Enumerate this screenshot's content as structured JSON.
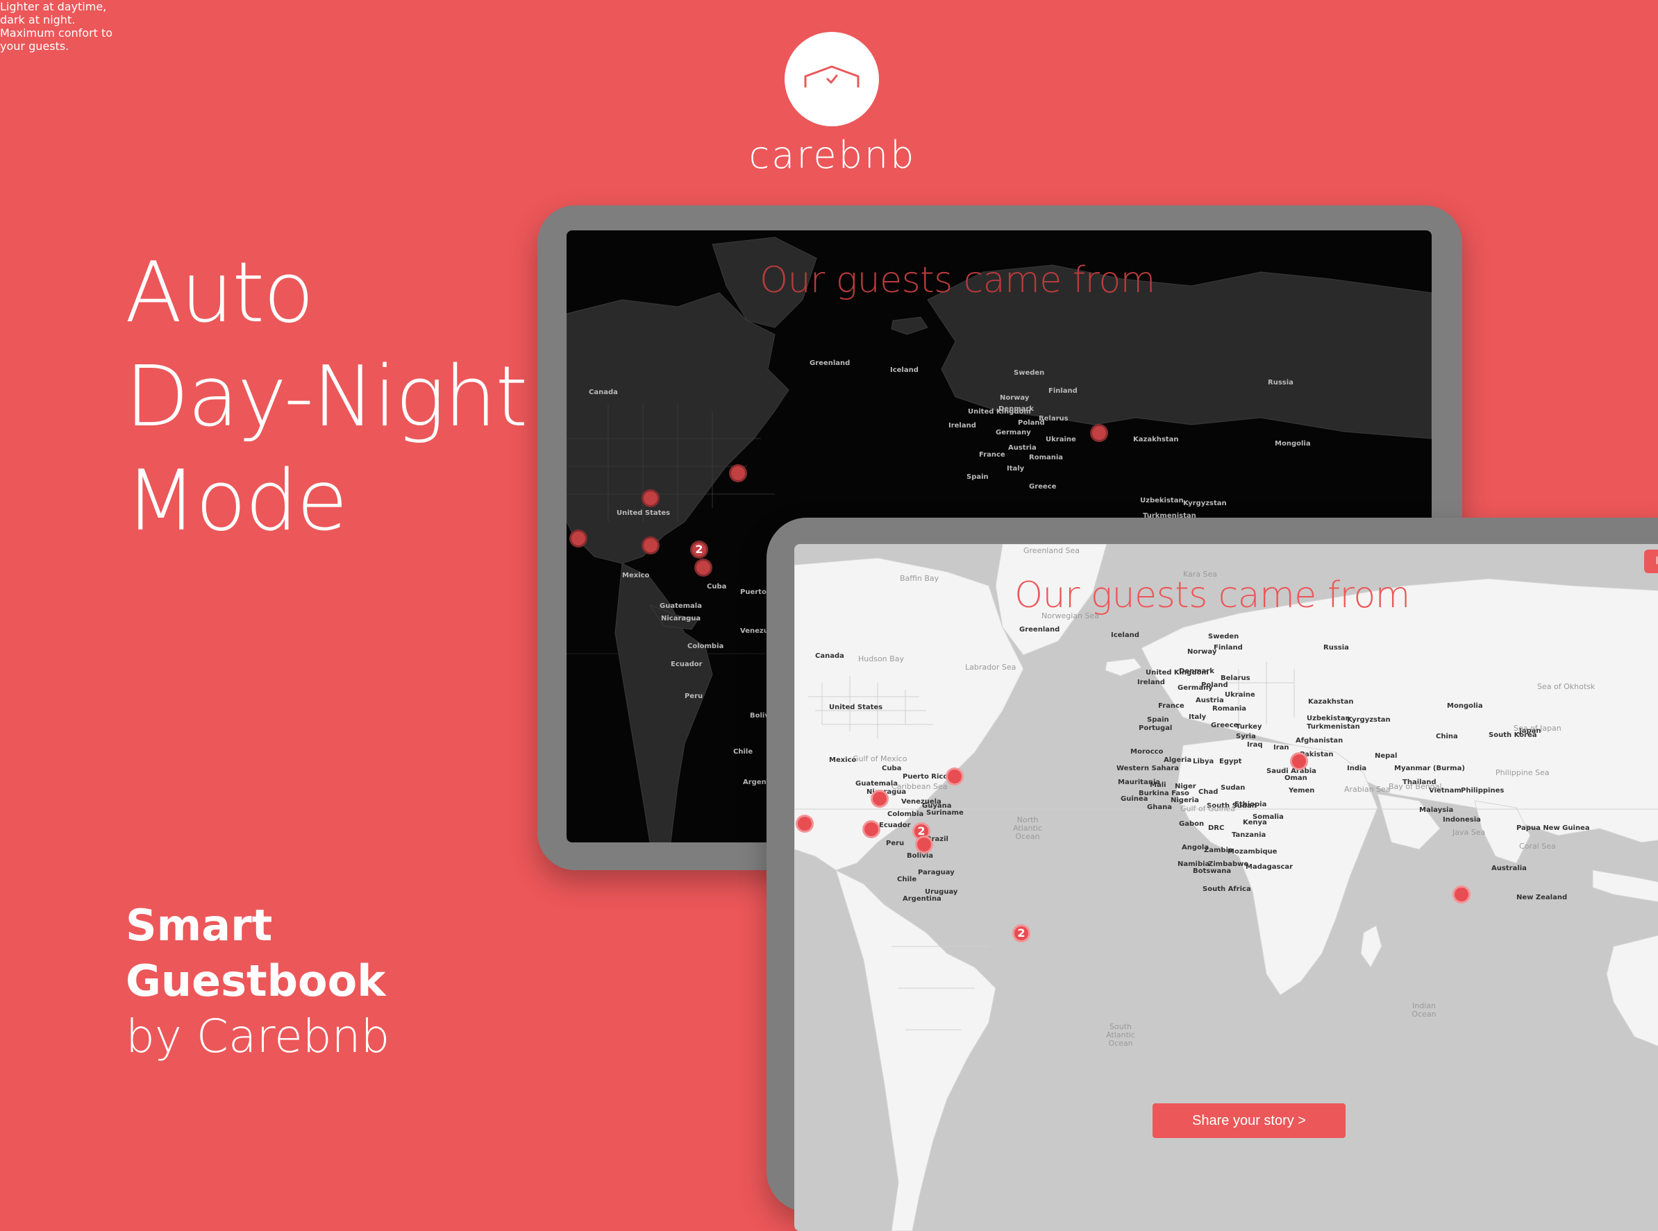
{
  "brand": {
    "logo_icon": "house-check-icon",
    "name": "carebnb"
  },
  "headline": [
    "Auto",
    "Day-Night",
    "Mode"
  ],
  "tagline": [
    "Lighter at daytime,",
    "dark at night.",
    "Maximum confort to",
    "your guests."
  ],
  "product": {
    "line1": "Smart",
    "line2": "Guestbook",
    "line3": "by Carebnb"
  },
  "dark_tablet": {
    "title": "Our guests came from",
    "labels": [
      "Greenland",
      "Iceland",
      "Sweden",
      "Finland",
      "Russia",
      "Norway",
      "Canada",
      "United Kingdom",
      "Ireland",
      "Denmark",
      "Belarus",
      "Poland",
      "Germany",
      "Ukraine",
      "France",
      "Austria",
      "Romania",
      "Kazakhstan",
      "Mongolia",
      "Italy",
      "Spain",
      "Greece",
      "United States",
      "Mexico",
      "Cuba",
      "Guatemala",
      "Nicaragua",
      "Puerto Rico",
      "Venezuela",
      "Colombia",
      "Ecuador",
      "Peru",
      "Bolivia",
      "Chile",
      "Argentina",
      "Uzbekistan",
      "Kyrgyzstan",
      "Turkmenistan"
    ],
    "cluster_count": "2"
  },
  "light_tablet": {
    "title": "Our guests came from",
    "toggle_label": "light",
    "share_label": "Share your story  >",
    "cluster_counts": [
      "2",
      "2"
    ],
    "labels": [
      "Greenland",
      "Iceland",
      "Sweden",
      "Finland",
      "Russia",
      "Norway",
      "Canada",
      "United Kingdom",
      "Ireland",
      "Denmark",
      "Belarus",
      "Poland",
      "Germany",
      "Ukraine",
      "France",
      "Austria",
      "Romania",
      "Kazakhstan",
      "Mongolia",
      "Uzbekistan",
      "Kyrgyzstan",
      "Turkmenistan",
      "Italy",
      "Spain",
      "Portugal",
      "Greece",
      "Turkey",
      "Syria",
      "Iraq",
      "Iran",
      "Afghanistan",
      "Pakistan",
      "China",
      "India",
      "Nepal",
      "South Korea",
      "Japan",
      "Myanmar (Burma)",
      "Thailand",
      "Vietnam",
      "Philippines",
      "Malaysia",
      "Indonesia",
      "Papua New Guinea",
      "Australia",
      "New Zealand",
      "Morocco",
      "Algeria",
      "Libya",
      "Egypt",
      "Saudi Arabia",
      "Oman",
      "Yemen",
      "Western Sahara",
      "Mauritania",
      "Mali",
      "Niger",
      "Chad",
      "Sudan",
      "South Sudan",
      "Ethiopia",
      "Somalia",
      "Burkina Faso",
      "Guinea",
      "Ghana",
      "Nigeria",
      "Gabon",
      "DRC",
      "Kenya",
      "Tanzania",
      "Angola",
      "Zambia",
      "Mozambique",
      "Namibia",
      "Zimbabwe",
      "Botswana",
      "Madagascar",
      "South Africa",
      "United States",
      "Mexico",
      "Cuba",
      "Guatemala",
      "Nicaragua",
      "Puerto Rico",
      "Venezuela",
      "Guyana",
      "Suriname",
      "Colombia",
      "Ecuador",
      "Peru",
      "Brazil",
      "Bolivia",
      "Paraguay",
      "Chile",
      "Uruguay",
      "Argentina",
      "Hudson Bay",
      "Baffin Bay",
      "Labrador Sea",
      "Greenland Sea",
      "Norwegian Sea",
      "Kara Sea",
      "Gulf of Mexico",
      "Caribbean Sea",
      "Arabian Sea",
      "Bay of Bengal",
      "Gulf of Guinea",
      "Philippine Sea",
      "Coral Sea",
      "Java Sea",
      "Sea of Japan",
      "Sea of Okhotsk",
      "North Atlantic Ocean",
      "South Atlantic Ocean",
      "Indian Ocean"
    ]
  },
  "colors": {
    "background": "#ec5759",
    "accent": "#ec5759",
    "tablet_frame": "#7e7e7e"
  }
}
